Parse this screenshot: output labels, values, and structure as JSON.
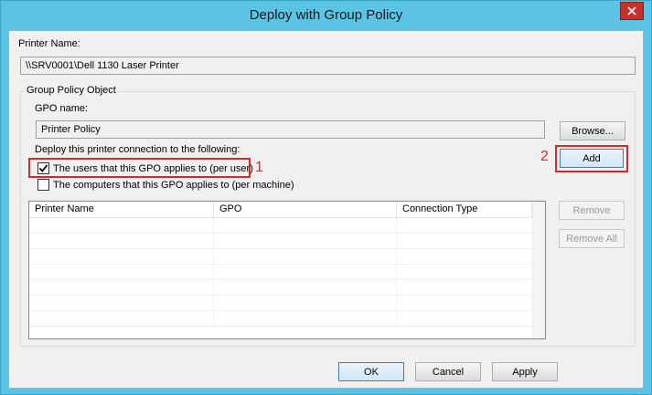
{
  "window": {
    "title": "Deploy with Group Policy"
  },
  "printer": {
    "label": "Printer Name:",
    "value": "\\\\SRV0001\\Dell 1130 Laser Printer"
  },
  "gpo_group": {
    "label": "Group Policy Object",
    "gpo_name_label": "GPO name:",
    "gpo_name_value": "Printer Policy",
    "browse_label": "Browse...",
    "deploy_label": "Deploy this printer connection to the following:",
    "per_user_label": "The users that this GPO applies to (per user)",
    "per_user_checked": true,
    "per_machine_label": "The computers that this GPO applies to (per machine)",
    "per_machine_checked": false,
    "add_label": "Add",
    "remove_label": "Remove",
    "remove_all_label": "Remove All",
    "columns": [
      "Printer Name",
      "GPO",
      "Connection Type"
    ]
  },
  "annotations": {
    "one": "1",
    "two": "2"
  },
  "footer": {
    "ok_label": "OK",
    "cancel_label": "Cancel",
    "apply_label": "Apply"
  },
  "colors": {
    "highlight": "#d9282b",
    "title_bar": "#5bc4e4",
    "close_button": "#c7312b"
  }
}
